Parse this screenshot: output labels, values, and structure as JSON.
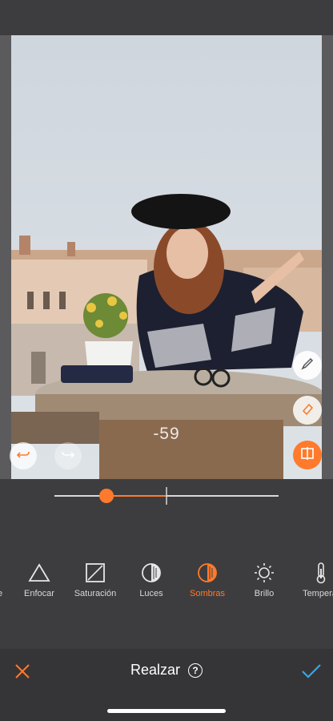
{
  "editor": {
    "value": "-59",
    "slider_level": -59,
    "title": "Realzar",
    "help_symbol": "?"
  },
  "tools": [
    {
      "label": "e",
      "icon": "partial-tool-icon"
    },
    {
      "label": "Enfocar",
      "icon": "triangle-icon"
    },
    {
      "label": "Saturación",
      "icon": "saturation-square-icon"
    },
    {
      "label": "Luces",
      "icon": "highlights-circle-icon"
    },
    {
      "label": "Sombras",
      "icon": "shadows-circle-icon",
      "active": true
    },
    {
      "label": "Brillo",
      "icon": "sun-icon"
    },
    {
      "label": "Temperat",
      "icon": "thermometer-icon"
    }
  ],
  "colors": {
    "accent": "#ff7a2c",
    "confirm": "#39a6e6",
    "panel": "#3d3d3f"
  },
  "side_buttons": [
    "brush-icon",
    "eraser-icon",
    "compare-icon"
  ],
  "nav_buttons": [
    "undo-icon",
    "redo-icon"
  ]
}
